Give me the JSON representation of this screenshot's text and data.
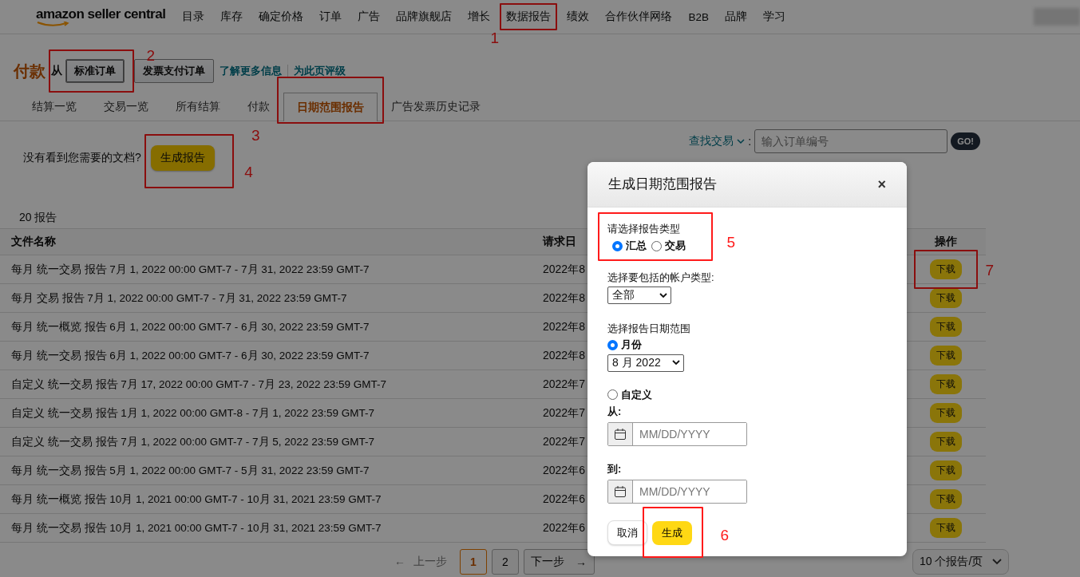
{
  "nav": {
    "logo": "amazon seller central",
    "items": [
      {
        "label": "目录"
      },
      {
        "label": "库存"
      },
      {
        "label": "确定价格"
      },
      {
        "label": "订单"
      },
      {
        "label": "广告"
      },
      {
        "label": "品牌旗舰店"
      },
      {
        "label": "增长"
      },
      {
        "label": "数据报告",
        "annotation": "1"
      },
      {
        "label": "绩效"
      },
      {
        "label": "合作伙伴网络"
      },
      {
        "label": "B2B"
      },
      {
        "label": "品牌"
      },
      {
        "label": "学习"
      }
    ]
  },
  "header": {
    "title": "付款",
    "from_label": "从",
    "order_buttons": [
      "标准订单",
      "发票支付订单"
    ],
    "annotation": "2",
    "links": [
      "了解更多信息",
      "为此页评级"
    ]
  },
  "tabs": [
    {
      "label": "结算一览",
      "selected": false
    },
    {
      "label": "交易一览",
      "selected": false
    },
    {
      "label": "所有结算",
      "selected": false
    },
    {
      "label": "付款",
      "selected": false
    },
    {
      "label": "日期范围报告",
      "selected": true,
      "annotation": "3"
    },
    {
      "label": "广告发票历史记录",
      "selected": false
    }
  ],
  "prompt": {
    "text": "没有看到您需要的文档?",
    "button": "生成报告",
    "annotation": "4"
  },
  "search": {
    "label": "查找交易",
    "suffix": ":",
    "placeholder": "输入订单编号",
    "button": "GO!"
  },
  "report_count": "20 报告",
  "table": {
    "columns": [
      "文件名称",
      "请求日",
      "操作"
    ],
    "rows": [
      {
        "name": "每月 统一交易 报告 7月 1, 2022 00:00 GMT-7 - 7月 31, 2022 23:59 GMT-7",
        "date": "2022年8",
        "action": "下载",
        "annotation": "7"
      },
      {
        "name": "每月 交易 报告 7月 1, 2022 00:00 GMT-7 - 7月 31, 2022 23:59 GMT-7",
        "date": "2022年8",
        "action": "下载"
      },
      {
        "name": "每月 统一概览 报告 6月 1, 2022 00:00 GMT-7 - 6月 30, 2022 23:59 GMT-7",
        "date": "2022年8",
        "action": "下载"
      },
      {
        "name": "每月 统一交易 报告 6月 1, 2022 00:00 GMT-7 - 6月 30, 2022 23:59 GMT-7",
        "date": "2022年8",
        "action": "下载"
      },
      {
        "name": "自定义 统一交易 报告 7月 17, 2022 00:00 GMT-7 - 7月 23, 2022 23:59 GMT-7",
        "date": "2022年7",
        "action": "下载"
      },
      {
        "name": "自定义 统一交易 报告 1月 1, 2022 00:00 GMT-8 - 7月 1, 2022 23:59 GMT-7",
        "date": "2022年7",
        "action": "下载"
      },
      {
        "name": "自定义 统一交易 报告 7月 1, 2022 00:00 GMT-7 - 7月 5, 2022 23:59 GMT-7",
        "date": "2022年7",
        "action": "下载"
      },
      {
        "name": "每月 统一交易 报告 5月 1, 2022 00:00 GMT-7 - 5月 31, 2022 23:59 GMT-7",
        "date": "2022年6",
        "action": "下载"
      },
      {
        "name": "每月 统一概览 报告 10月 1, 2021 00:00 GMT-7 - 10月 31, 2021 23:59 GMT-7",
        "date": "2022年6",
        "action": "下载"
      },
      {
        "name": "每月 统一交易 报告 10月 1, 2021 00:00 GMT-7 - 10月 31, 2021 23:59 GMT-7",
        "date": "2022年6",
        "action": "下载"
      }
    ]
  },
  "pagination": {
    "prev_arrow": "←",
    "prev": "上一步",
    "pages": [
      {
        "label": "1",
        "selected": true
      },
      {
        "label": "2",
        "selected": false
      }
    ],
    "next": "下一步",
    "next_arrow": "→",
    "page_size": "10 个报告/页"
  },
  "modal": {
    "title": "生成日期范围报告",
    "close": "×",
    "type_label": "请选择报告类型",
    "type_annotation": "5",
    "report_types": [
      {
        "label": "汇总",
        "selected": true
      },
      {
        "label": "交易",
        "selected": false
      }
    ],
    "account_label": "选择要包括的帐户类型:",
    "account_value": "全部",
    "range_label": "选择报告日期范围",
    "range_options": [
      {
        "kind": "month",
        "label": "月份",
        "selected": true,
        "value": "8 月 2022"
      },
      {
        "kind": "custom",
        "label": "自定义",
        "selected": false,
        "from_label": "从:",
        "from_placeholder": "MM/DD/YYYY",
        "to_label": "到:",
        "to_placeholder": "MM/DD/YYYY"
      }
    ],
    "cancel": "取消",
    "generate": "生成",
    "generate_annotation": "6"
  }
}
